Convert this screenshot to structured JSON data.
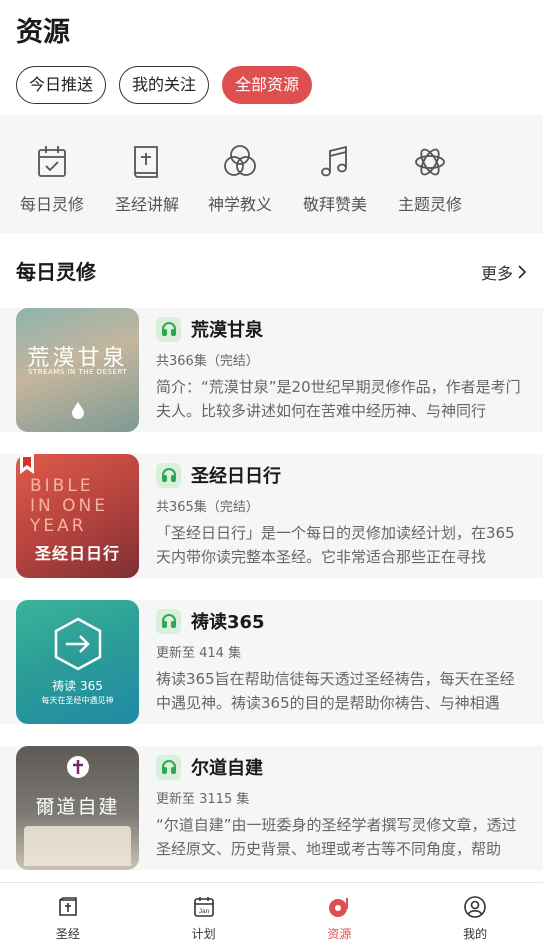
{
  "header": {
    "title": "资源"
  },
  "chips": [
    {
      "label": "今日推送",
      "active": false
    },
    {
      "label": "我的关注",
      "active": false
    },
    {
      "label": "全部资源",
      "active": true
    }
  ],
  "categories": [
    {
      "label": "每日灵修",
      "icon": "calendar-check-icon"
    },
    {
      "label": "圣经讲解",
      "icon": "bible-book-icon"
    },
    {
      "label": "神学教义",
      "icon": "venn-circles-icon"
    },
    {
      "label": "敬拜赞美",
      "icon": "music-note-icon"
    },
    {
      "label": "主题灵修",
      "icon": "atom-icon"
    }
  ],
  "section": {
    "title": "每日灵修",
    "more_label": "更多"
  },
  "resources": [
    {
      "title": "荒漠甘泉",
      "meta": "共366集（完结）",
      "description": "简介：“荒漠甘泉”是20世纪早期灵修作品，作者是考门夫人。比较多讲述如何在苦难中经历神、与神同行",
      "thumb_title": "荒漠甘泉",
      "thumb_subtitle": "STREAMS IN THE DESERT"
    },
    {
      "title": "圣经日日行",
      "meta": "共365集（完结）",
      "description": "「圣经日日行」是一个每日的灵修加读经计划，在365天内带你读完整本圣经。它非常适合那些正在寻找",
      "thumb_title": "圣经日日行",
      "thumb_subtitle": "BIBLE IN ONE YEAR"
    },
    {
      "title": "祷读365",
      "meta": "更新至 414 集",
      "description": "祷读365旨在帮助信徒每天透过圣经祷告，每天在圣经中遇见神。祷读365的目的是帮助你祷告、与神相遇",
      "thumb_title": "祷读 365",
      "thumb_subtitle": "每天在圣经中遇见神"
    },
    {
      "title": "尔道自建",
      "meta": "更新至 3115 集",
      "description": "“尔道自建”由一班委身的圣经学者撰写灵修文章，透过圣经原文、历史背景、地理或考古等不同角度，帮助",
      "thumb_title": "爾道自建",
      "thumb_subtitle": ""
    }
  ],
  "bottom_nav": [
    {
      "label": "圣经",
      "icon": "bible-icon",
      "active": false
    },
    {
      "label": "计划",
      "icon": "calendar-jan-icon",
      "active": false
    },
    {
      "label": "资源",
      "icon": "resource-disc-icon",
      "active": true
    },
    {
      "label": "我的",
      "icon": "profile-icon",
      "active": false
    }
  ],
  "colors": {
    "accent": "#de4f4f",
    "audio_green": "#2fa84f",
    "panel_bg": "#f6f6f6"
  }
}
